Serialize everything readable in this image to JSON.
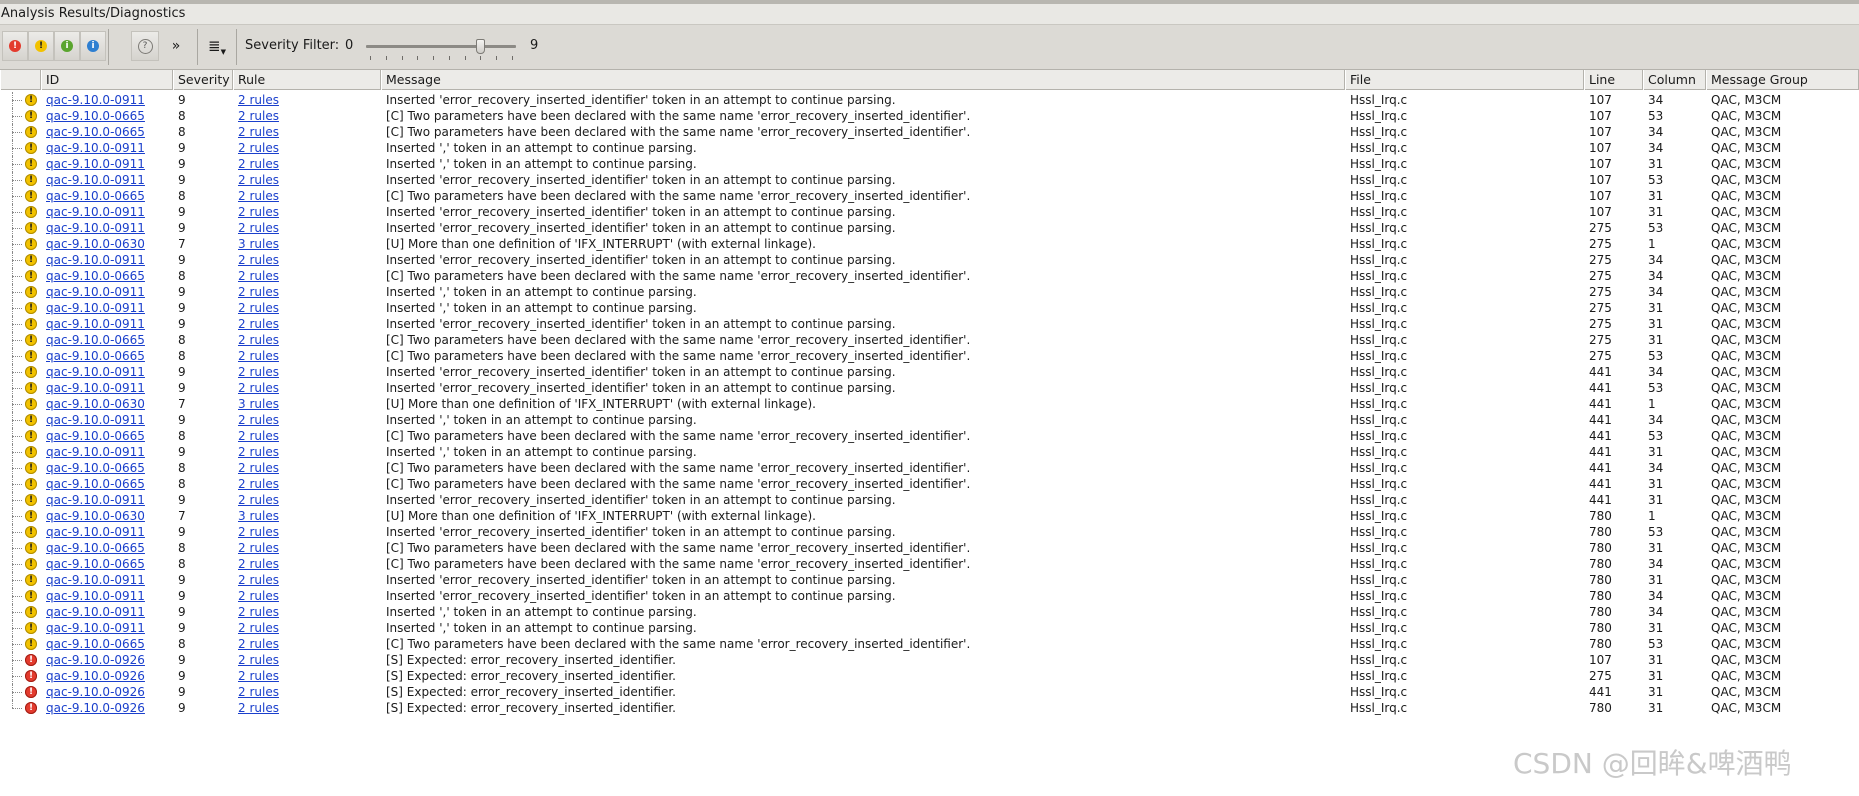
{
  "window": {
    "title": "Analysis Results/Diagnostics"
  },
  "toolbar": {
    "buttons": [
      {
        "name": "error-filter-button",
        "icon": "red-exclamation-icon",
        "color": "#e33b2e",
        "glyph": "!"
      },
      {
        "name": "warning-filter-button",
        "icon": "yellow-exclamation-icon",
        "color": "#f2c200",
        "glyph": "!"
      },
      {
        "name": "info-filter-button",
        "icon": "green-info-icon",
        "color": "#5aa52e",
        "glyph": "i"
      },
      {
        "name": "message-filter-button",
        "icon": "blue-message-icon",
        "color": "#2e7fd1",
        "glyph": "i"
      }
    ],
    "help_icon": "question-icon",
    "more_icon": "double-chevron-right-icon",
    "more_glyph": "»",
    "menu_icon": "list-menu-icon",
    "menu_glyph": "≣",
    "severity_filter_label": "Severity Filter:",
    "severity_min": "0",
    "severity_max": "9",
    "severity_value": 7
  },
  "table": {
    "columns": [
      "ID",
      "Severity",
      "Rule",
      "Message",
      "File",
      "Line",
      "Column",
      "Message Group"
    ],
    "rows": [
      {
        "id": "qac-9.10.0-0911",
        "severity": "9",
        "rule": "2 rules",
        "message": "Inserted 'error_recovery_inserted_identifier' token in an attempt to continue parsing.",
        "file": "Hssl_Irq.c",
        "line": "107",
        "column": "34",
        "group": "QAC, M3CM",
        "level": "warning"
      },
      {
        "id": "qac-9.10.0-0665",
        "severity": "8",
        "rule": "2 rules",
        "message": "[C] Two parameters have been declared with the same name 'error_recovery_inserted_identifier'.",
        "file": "Hssl_Irq.c",
        "line": "107",
        "column": "53",
        "group": "QAC, M3CM",
        "level": "warning"
      },
      {
        "id": "qac-9.10.0-0665",
        "severity": "8",
        "rule": "2 rules",
        "message": "[C] Two parameters have been declared with the same name 'error_recovery_inserted_identifier'.",
        "file": "Hssl_Irq.c",
        "line": "107",
        "column": "34",
        "group": "QAC, M3CM",
        "level": "warning"
      },
      {
        "id": "qac-9.10.0-0911",
        "severity": "9",
        "rule": "2 rules",
        "message": "Inserted ',' token in an attempt to continue parsing.",
        "file": "Hssl_Irq.c",
        "line": "107",
        "column": "34",
        "group": "QAC, M3CM",
        "level": "warning"
      },
      {
        "id": "qac-9.10.0-0911",
        "severity": "9",
        "rule": "2 rules",
        "message": "Inserted ',' token in an attempt to continue parsing.",
        "file": "Hssl_Irq.c",
        "line": "107",
        "column": "31",
        "group": "QAC, M3CM",
        "level": "warning"
      },
      {
        "id": "qac-9.10.0-0911",
        "severity": "9",
        "rule": "2 rules",
        "message": "Inserted 'error_recovery_inserted_identifier' token in an attempt to continue parsing.",
        "file": "Hssl_Irq.c",
        "line": "107",
        "column": "53",
        "group": "QAC, M3CM",
        "level": "warning"
      },
      {
        "id": "qac-9.10.0-0665",
        "severity": "8",
        "rule": "2 rules",
        "message": "[C] Two parameters have been declared with the same name 'error_recovery_inserted_identifier'.",
        "file": "Hssl_Irq.c",
        "line": "107",
        "column": "31",
        "group": "QAC, M3CM",
        "level": "warning"
      },
      {
        "id": "qac-9.10.0-0911",
        "severity": "9",
        "rule": "2 rules",
        "message": "Inserted 'error_recovery_inserted_identifier' token in an attempt to continue parsing.",
        "file": "Hssl_Irq.c",
        "line": "107",
        "column": "31",
        "group": "QAC, M3CM",
        "level": "warning"
      },
      {
        "id": "qac-9.10.0-0911",
        "severity": "9",
        "rule": "2 rules",
        "message": "Inserted 'error_recovery_inserted_identifier' token in an attempt to continue parsing.",
        "file": "Hssl_Irq.c",
        "line": "275",
        "column": "53",
        "group": "QAC, M3CM",
        "level": "warning"
      },
      {
        "id": "qac-9.10.0-0630",
        "severity": "7",
        "rule": "3 rules",
        "message": "[U] More than one definition of 'IFX_INTERRUPT' (with external linkage).",
        "file": "Hssl_Irq.c",
        "line": "275",
        "column": "1",
        "group": "QAC, M3CM",
        "level": "warning"
      },
      {
        "id": "qac-9.10.0-0911",
        "severity": "9",
        "rule": "2 rules",
        "message": "Inserted 'error_recovery_inserted_identifier' token in an attempt to continue parsing.",
        "file": "Hssl_Irq.c",
        "line": "275",
        "column": "34",
        "group": "QAC, M3CM",
        "level": "warning"
      },
      {
        "id": "qac-9.10.0-0665",
        "severity": "8",
        "rule": "2 rules",
        "message": "[C] Two parameters have been declared with the same name 'error_recovery_inserted_identifier'.",
        "file": "Hssl_Irq.c",
        "line": "275",
        "column": "34",
        "group": "QAC, M3CM",
        "level": "warning"
      },
      {
        "id": "qac-9.10.0-0911",
        "severity": "9",
        "rule": "2 rules",
        "message": "Inserted ',' token in an attempt to continue parsing.",
        "file": "Hssl_Irq.c",
        "line": "275",
        "column": "34",
        "group": "QAC, M3CM",
        "level": "warning"
      },
      {
        "id": "qac-9.10.0-0911",
        "severity": "9",
        "rule": "2 rules",
        "message": "Inserted ',' token in an attempt to continue parsing.",
        "file": "Hssl_Irq.c",
        "line": "275",
        "column": "31",
        "group": "QAC, M3CM",
        "level": "warning"
      },
      {
        "id": "qac-9.10.0-0911",
        "severity": "9",
        "rule": "2 rules",
        "message": "Inserted 'error_recovery_inserted_identifier' token in an attempt to continue parsing.",
        "file": "Hssl_Irq.c",
        "line": "275",
        "column": "31",
        "group": "QAC, M3CM",
        "level": "warning"
      },
      {
        "id": "qac-9.10.0-0665",
        "severity": "8",
        "rule": "2 rules",
        "message": "[C] Two parameters have been declared with the same name 'error_recovery_inserted_identifier'.",
        "file": "Hssl_Irq.c",
        "line": "275",
        "column": "31",
        "group": "QAC, M3CM",
        "level": "warning"
      },
      {
        "id": "qac-9.10.0-0665",
        "severity": "8",
        "rule": "2 rules",
        "message": "[C] Two parameters have been declared with the same name 'error_recovery_inserted_identifier'.",
        "file": "Hssl_Irq.c",
        "line": "275",
        "column": "53",
        "group": "QAC, M3CM",
        "level": "warning"
      },
      {
        "id": "qac-9.10.0-0911",
        "severity": "9",
        "rule": "2 rules",
        "message": "Inserted 'error_recovery_inserted_identifier' token in an attempt to continue parsing.",
        "file": "Hssl_Irq.c",
        "line": "441",
        "column": "34",
        "group": "QAC, M3CM",
        "level": "warning"
      },
      {
        "id": "qac-9.10.0-0911",
        "severity": "9",
        "rule": "2 rules",
        "message": "Inserted 'error_recovery_inserted_identifier' token in an attempt to continue parsing.",
        "file": "Hssl_Irq.c",
        "line": "441",
        "column": "53",
        "group": "QAC, M3CM",
        "level": "warning"
      },
      {
        "id": "qac-9.10.0-0630",
        "severity": "7",
        "rule": "3 rules",
        "message": "[U] More than one definition of 'IFX_INTERRUPT' (with external linkage).",
        "file": "Hssl_Irq.c",
        "line": "441",
        "column": "1",
        "group": "QAC, M3CM",
        "level": "warning"
      },
      {
        "id": "qac-9.10.0-0911",
        "severity": "9",
        "rule": "2 rules",
        "message": "Inserted ',' token in an attempt to continue parsing.",
        "file": "Hssl_Irq.c",
        "line": "441",
        "column": "34",
        "group": "QAC, M3CM",
        "level": "warning"
      },
      {
        "id": "qac-9.10.0-0665",
        "severity": "8",
        "rule": "2 rules",
        "message": "[C] Two parameters have been declared with the same name 'error_recovery_inserted_identifier'.",
        "file": "Hssl_Irq.c",
        "line": "441",
        "column": "53",
        "group": "QAC, M3CM",
        "level": "warning"
      },
      {
        "id": "qac-9.10.0-0911",
        "severity": "9",
        "rule": "2 rules",
        "message": "Inserted ',' token in an attempt to continue parsing.",
        "file": "Hssl_Irq.c",
        "line": "441",
        "column": "31",
        "group": "QAC, M3CM",
        "level": "warning"
      },
      {
        "id": "qac-9.10.0-0665",
        "severity": "8",
        "rule": "2 rules",
        "message": "[C] Two parameters have been declared with the same name 'error_recovery_inserted_identifier'.",
        "file": "Hssl_Irq.c",
        "line": "441",
        "column": "34",
        "group": "QAC, M3CM",
        "level": "warning"
      },
      {
        "id": "qac-9.10.0-0665",
        "severity": "8",
        "rule": "2 rules",
        "message": "[C] Two parameters have been declared with the same name 'error_recovery_inserted_identifier'.",
        "file": "Hssl_Irq.c",
        "line": "441",
        "column": "31",
        "group": "QAC, M3CM",
        "level": "warning"
      },
      {
        "id": "qac-9.10.0-0911",
        "severity": "9",
        "rule": "2 rules",
        "message": "Inserted 'error_recovery_inserted_identifier' token in an attempt to continue parsing.",
        "file": "Hssl_Irq.c",
        "line": "441",
        "column": "31",
        "group": "QAC, M3CM",
        "level": "warning"
      },
      {
        "id": "qac-9.10.0-0630",
        "severity": "7",
        "rule": "3 rules",
        "message": "[U] More than one definition of 'IFX_INTERRUPT' (with external linkage).",
        "file": "Hssl_Irq.c",
        "line": "780",
        "column": "1",
        "group": "QAC, M3CM",
        "level": "warning"
      },
      {
        "id": "qac-9.10.0-0911",
        "severity": "9",
        "rule": "2 rules",
        "message": "Inserted 'error_recovery_inserted_identifier' token in an attempt to continue parsing.",
        "file": "Hssl_Irq.c",
        "line": "780",
        "column": "53",
        "group": "QAC, M3CM",
        "level": "warning"
      },
      {
        "id": "qac-9.10.0-0665",
        "severity": "8",
        "rule": "2 rules",
        "message": "[C] Two parameters have been declared with the same name 'error_recovery_inserted_identifier'.",
        "file": "Hssl_Irq.c",
        "line": "780",
        "column": "31",
        "group": "QAC, M3CM",
        "level": "warning"
      },
      {
        "id": "qac-9.10.0-0665",
        "severity": "8",
        "rule": "2 rules",
        "message": "[C] Two parameters have been declared with the same name 'error_recovery_inserted_identifier'.",
        "file": "Hssl_Irq.c",
        "line": "780",
        "column": "34",
        "group": "QAC, M3CM",
        "level": "warning"
      },
      {
        "id": "qac-9.10.0-0911",
        "severity": "9",
        "rule": "2 rules",
        "message": "Inserted 'error_recovery_inserted_identifier' token in an attempt to continue parsing.",
        "file": "Hssl_Irq.c",
        "line": "780",
        "column": "31",
        "group": "QAC, M3CM",
        "level": "warning"
      },
      {
        "id": "qac-9.10.0-0911",
        "severity": "9",
        "rule": "2 rules",
        "message": "Inserted 'error_recovery_inserted_identifier' token in an attempt to continue parsing.",
        "file": "Hssl_Irq.c",
        "line": "780",
        "column": "34",
        "group": "QAC, M3CM",
        "level": "warning"
      },
      {
        "id": "qac-9.10.0-0911",
        "severity": "9",
        "rule": "2 rules",
        "message": "Inserted ',' token in an attempt to continue parsing.",
        "file": "Hssl_Irq.c",
        "line": "780",
        "column": "34",
        "group": "QAC, M3CM",
        "level": "warning"
      },
      {
        "id": "qac-9.10.0-0911",
        "severity": "9",
        "rule": "2 rules",
        "message": "Inserted ',' token in an attempt to continue parsing.",
        "file": "Hssl_Irq.c",
        "line": "780",
        "column": "31",
        "group": "QAC, M3CM",
        "level": "warning"
      },
      {
        "id": "qac-9.10.0-0665",
        "severity": "8",
        "rule": "2 rules",
        "message": "[C] Two parameters have been declared with the same name 'error_recovery_inserted_identifier'.",
        "file": "Hssl_Irq.c",
        "line": "780",
        "column": "53",
        "group": "QAC, M3CM",
        "level": "warning"
      },
      {
        "id": "qac-9.10.0-0926",
        "severity": "9",
        "rule": "2 rules",
        "message": "[S] Expected: error_recovery_inserted_identifier.",
        "file": "Hssl_Irq.c",
        "line": "107",
        "column": "31",
        "group": "QAC, M3CM",
        "level": "error"
      },
      {
        "id": "qac-9.10.0-0926",
        "severity": "9",
        "rule": "2 rules",
        "message": "[S] Expected: error_recovery_inserted_identifier.",
        "file": "Hssl_Irq.c",
        "line": "275",
        "column": "31",
        "group": "QAC, M3CM",
        "level": "error"
      },
      {
        "id": "qac-9.10.0-0926",
        "severity": "9",
        "rule": "2 rules",
        "message": "[S] Expected: error_recovery_inserted_identifier.",
        "file": "Hssl_Irq.c",
        "line": "441",
        "column": "31",
        "group": "QAC, M3CM",
        "level": "error"
      },
      {
        "id": "qac-9.10.0-0926",
        "severity": "9",
        "rule": "2 rules",
        "message": "[S] Expected: error_recovery_inserted_identifier.",
        "file": "Hssl_Irq.c",
        "line": "780",
        "column": "31",
        "group": "QAC, M3CM",
        "level": "error"
      }
    ]
  },
  "colors": {
    "warning": "#f2c200",
    "error": "#e33b2e",
    "link": "#1a3fcc"
  },
  "watermark": "CSDN @回眸&啤酒鸭"
}
